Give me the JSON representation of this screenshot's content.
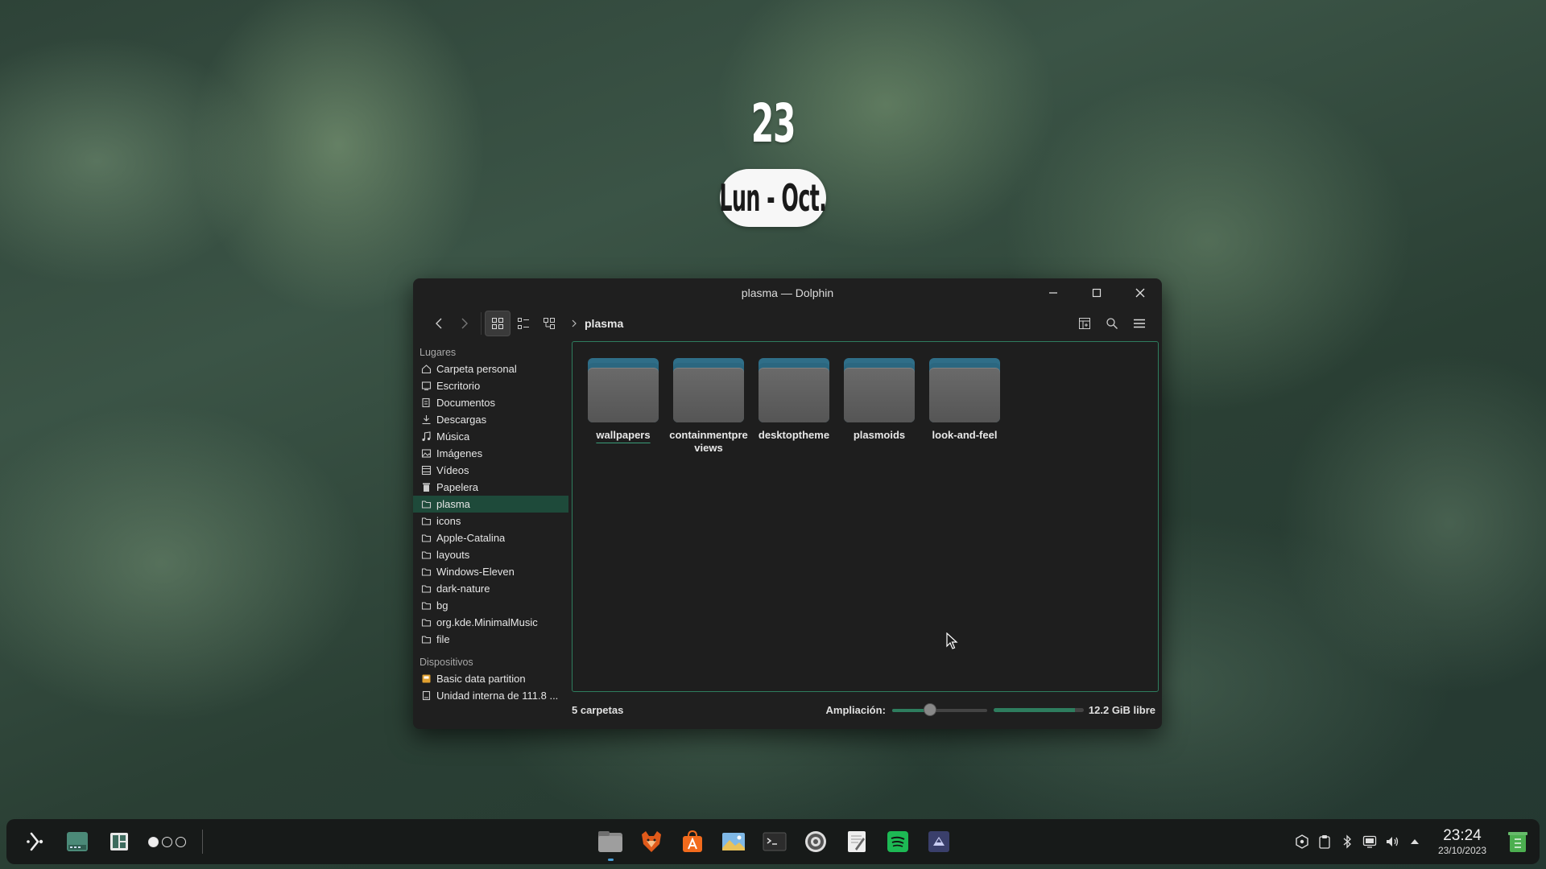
{
  "desktop_widget": {
    "day": "23",
    "date": "Lun - Oct."
  },
  "window": {
    "title": "plasma — Dolphin",
    "breadcrumb": "plasma"
  },
  "sidebar": {
    "places_title": "Lugares",
    "places": [
      {
        "label": "Carpeta personal",
        "icon": "home-icon"
      },
      {
        "label": "Escritorio",
        "icon": "desktop-icon"
      },
      {
        "label": "Documentos",
        "icon": "documents-icon"
      },
      {
        "label": "Descargas",
        "icon": "download-icon"
      },
      {
        "label": "Música",
        "icon": "music-icon"
      },
      {
        "label": "Imágenes",
        "icon": "image-icon"
      },
      {
        "label": "Vídeos",
        "icon": "video-icon"
      },
      {
        "label": "Papelera",
        "icon": "trash-icon"
      },
      {
        "label": "plasma",
        "icon": "folder-icon",
        "selected": true
      },
      {
        "label": "icons",
        "icon": "folder-icon"
      },
      {
        "label": "Apple-Catalina",
        "icon": "folder-icon"
      },
      {
        "label": "layouts",
        "icon": "folder-icon"
      },
      {
        "label": "Windows-Eleven",
        "icon": "folder-icon"
      },
      {
        "label": "dark-nature",
        "icon": "folder-icon"
      },
      {
        "label": "bg",
        "icon": "folder-icon"
      },
      {
        "label": "org.kde.MinimalMusic",
        "icon": "folder-icon"
      },
      {
        "label": "file",
        "icon": "folder-icon"
      }
    ],
    "devices_title": "Dispositivos",
    "devices": [
      {
        "label": "Basic data partition",
        "icon": "partition-icon"
      },
      {
        "label": "Unidad interna de 111.8 ...",
        "icon": "drive-icon"
      }
    ]
  },
  "folders": [
    {
      "name": "wallpapers"
    },
    {
      "name": "containmentpreviews"
    },
    {
      "name": "desktoptheme"
    },
    {
      "name": "plasmoids"
    },
    {
      "name": "look-and-feel"
    }
  ],
  "status": {
    "count": "5 carpetas",
    "zoom_label": "Ampliación:",
    "zoom_level": 0.4,
    "free_space": "12.2 GiB libre",
    "used_fraction": 0.9
  },
  "taskbar": {
    "time": "23:24",
    "date": "23/10/2023"
  },
  "colors": {
    "accent": "#2e7d5e",
    "selection": "#1e4a3a",
    "folder_tab": "#2f6e88"
  }
}
